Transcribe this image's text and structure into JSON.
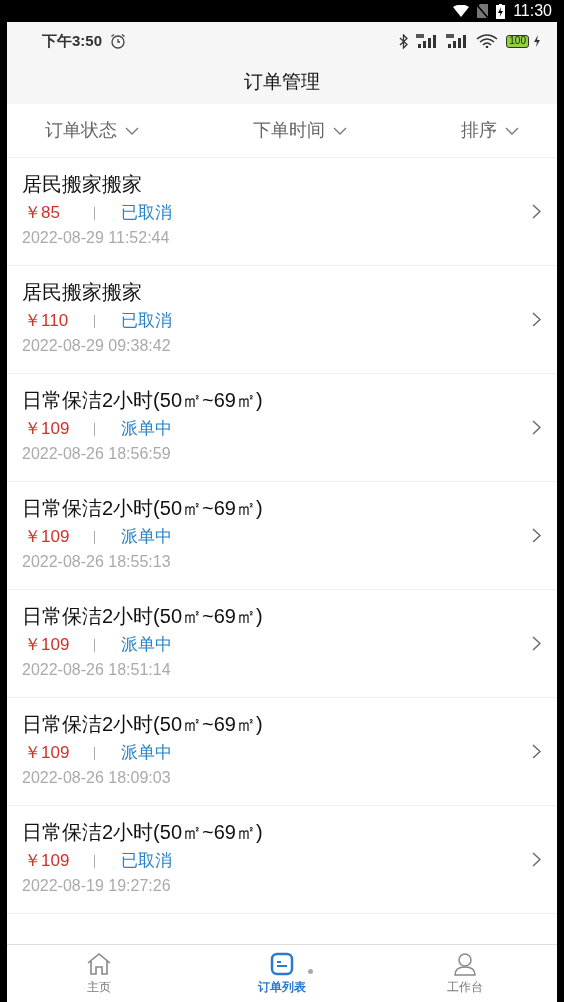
{
  "system_status": {
    "time": "11:30"
  },
  "app_status": {
    "time": "下午3:50",
    "battery": "100"
  },
  "title": "订单管理",
  "filters": [
    {
      "label": "订单状态"
    },
    {
      "label": "下单时间"
    },
    {
      "label": "排序"
    }
  ],
  "orders": [
    {
      "name": "居民搬家搬家",
      "price": "￥85",
      "status": "已取消",
      "time": "2022-08-29 11:52:44"
    },
    {
      "name": "居民搬家搬家",
      "price": "￥110",
      "status": "已取消",
      "time": "2022-08-29 09:38:42"
    },
    {
      "name": "日常保洁2小时(50㎡~69㎡)",
      "price": "￥109",
      "status": "派单中",
      "time": "2022-08-26 18:56:59"
    },
    {
      "name": "日常保洁2小时(50㎡~69㎡)",
      "price": "￥109",
      "status": "派单中",
      "time": "2022-08-26 18:55:13"
    },
    {
      "name": "日常保洁2小时(50㎡~69㎡)",
      "price": "￥109",
      "status": "派单中",
      "time": "2022-08-26 18:51:14"
    },
    {
      "name": "日常保洁2小时(50㎡~69㎡)",
      "price": "￥109",
      "status": "派单中",
      "time": "2022-08-26 18:09:03"
    },
    {
      "name": "日常保洁2小时(50㎡~69㎡)",
      "price": "￥109",
      "status": "已取消",
      "time": "2022-08-19 19:27:26"
    }
  ],
  "nav": [
    {
      "kind": "home",
      "label": "主页",
      "selected": false
    },
    {
      "kind": "list",
      "label": "订单列表",
      "selected": true
    },
    {
      "kind": "user",
      "label": "工作台",
      "selected": false
    }
  ]
}
